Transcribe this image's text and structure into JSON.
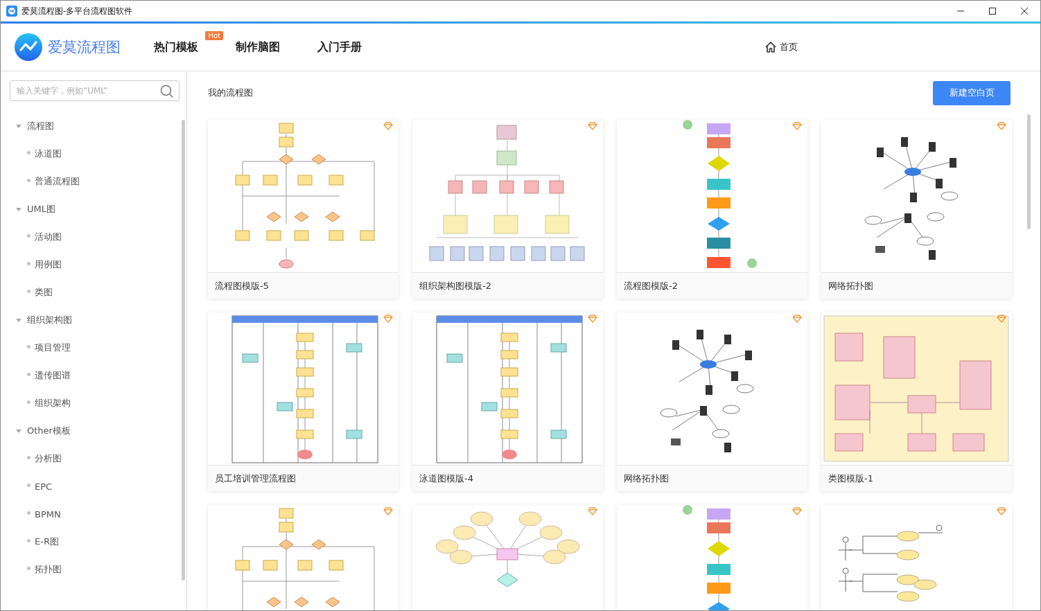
{
  "window": {
    "title": "爱莫流程图-多平台流程图软件"
  },
  "header": {
    "brand": "爱莫流程图",
    "nav": [
      {
        "label": "热门模板",
        "badge": "Hot"
      },
      {
        "label": "制作脑图"
      },
      {
        "label": "入门手册"
      }
    ],
    "home": "首页"
  },
  "search": {
    "placeholder": "输入关键字，例如“UML”"
  },
  "sidebar": {
    "items": [
      {
        "label": "流程图",
        "expanded": true,
        "children": [
          {
            "label": "泳道图"
          },
          {
            "label": "普通流程图"
          }
        ]
      },
      {
        "label": "UML图",
        "expanded": true,
        "children": [
          {
            "label": "活动图"
          },
          {
            "label": "用例图"
          },
          {
            "label": "类图"
          }
        ]
      },
      {
        "label": "组织架构图",
        "expanded": true,
        "children": [
          {
            "label": "项目管理"
          },
          {
            "label": "遗传图谱"
          },
          {
            "label": "组织架构"
          }
        ]
      },
      {
        "label": "Other模板",
        "expanded": true,
        "children": [
          {
            "label": "分析图"
          },
          {
            "label": "EPC"
          },
          {
            "label": "BPMN"
          },
          {
            "label": "E-R图"
          },
          {
            "label": "拓扑图"
          }
        ]
      }
    ]
  },
  "content": {
    "title": "我的流程图",
    "new_button": "新建空白页",
    "cards": [
      {
        "title": "流程图模版-5",
        "kind": "flowchart"
      },
      {
        "title": "组织架构图模版-2",
        "kind": "org"
      },
      {
        "title": "流程图模版-2",
        "kind": "vertical"
      },
      {
        "title": "网络拓扑图",
        "kind": "network"
      },
      {
        "title": "员工培训管理流程图",
        "kind": "swimlane"
      },
      {
        "title": "泳道图模版-4",
        "kind": "swimlane"
      },
      {
        "title": "网络拓扑图",
        "kind": "network"
      },
      {
        "title": "类图模版-1",
        "kind": "class"
      },
      {
        "kind": "flowchart"
      },
      {
        "kind": "mindmap"
      },
      {
        "kind": "vertical"
      },
      {
        "kind": "usecase"
      }
    ]
  }
}
